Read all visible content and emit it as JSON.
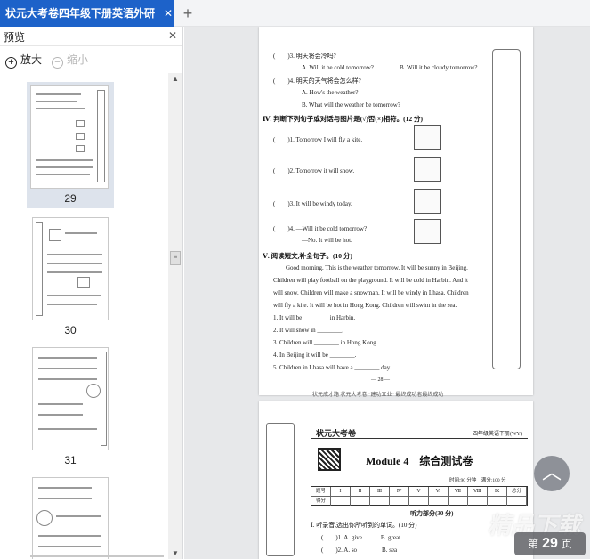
{
  "tab": {
    "title": "状元大考卷四年级下册英语外研",
    "close": "✕",
    "add": "+"
  },
  "sidebar": {
    "title": "预览",
    "close": "✕",
    "zoom_in": "放大",
    "zoom_out": "缩小",
    "thumbnails": [
      {
        "page": "29",
        "selected": true
      },
      {
        "page": "30",
        "selected": false
      },
      {
        "page": "31",
        "selected": false
      },
      {
        "page": "",
        "selected": false
      }
    ]
  },
  "page1": {
    "lines": [
      {
        "t": "(　　)3. 明天将会冷吗?"
      },
      {
        "t": "A. Will it be cold tomorrow?"
      },
      {
        "t": "B. Will it be cloudy tomorrow?"
      },
      {
        "t": "(　　)4. 明天的天气将会怎么样?"
      },
      {
        "t": "A. How's the weather?"
      },
      {
        "t": "B. What will the weather be tomorrow?"
      }
    ],
    "section4": "Ⅳ. 判断下列句子或对话与图片是(√)否(×)相符。(12 分)",
    "judge": [
      "(　　)1. Tomorrow I will fly a kite.",
      "(　　)2. Tomorrow it will snow.",
      "(　　)3. It will be windy today.",
      "(　　)4. —Will it be cold tomorrow?",
      "—No. It will be hot."
    ],
    "section5": "Ⅴ. 阅读短文,补全句子。(10 分)",
    "passage": [
      "Good morning. This is the weather tomorrow. It will be sunny in Beijing.",
      "Children will play football on the playground. It will be cold in Harbin. And it",
      "will snow. Children will make a snowman. It will be windy in Lhasa. Children",
      "will fly a kite. It will be hot in Hong Kong. Children will swim in the sea."
    ],
    "fill": [
      "1. It will be ________ in Harbin.",
      "2. It will snow in ________.",
      "3. Children will ________ in Hong Kong.",
      "4. In Beijing it will be ________.",
      "5. Children in Lhasa will have a ________ day."
    ],
    "page_number": "— 28 —",
    "footer": "状元成才路 状元大考卷 \"建功立业\" 最终成功者最终成功"
  },
  "page2": {
    "brand": "状元大考卷",
    "version": "四年级英语下册(WY)",
    "module_title": "Module 4　综合测试卷",
    "score_header": [
      "题号",
      "Ⅰ",
      "Ⅱ",
      "Ⅲ",
      "Ⅳ",
      "Ⅴ",
      "Ⅵ",
      "Ⅶ",
      "Ⅷ",
      "Ⅸ",
      "总分"
    ],
    "score_row": "得分",
    "listening": "听力部分(30 分)",
    "q1": "Ⅰ. 听录音,选出你所听到的单词。(10 分)",
    "q1_1": "(　　)1. A. give　　　B. great",
    "q1_2": "(　　)2. A. so　　　　B. sea",
    "time": "时间:90 分钟　满分:100 分"
  },
  "indicator": {
    "prefix": "第",
    "page": "29",
    "suffix": "页"
  },
  "watermark": "精品下载",
  "back_top": "︿"
}
